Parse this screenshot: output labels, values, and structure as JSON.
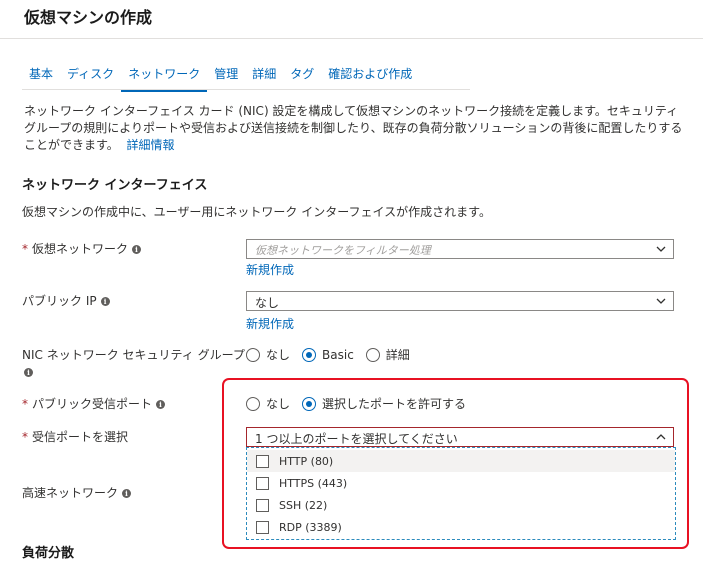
{
  "page": {
    "title": "仮想マシンの作成"
  },
  "tabs": [
    {
      "label": "基本"
    },
    {
      "label": "ディスク"
    },
    {
      "label": "ネットワーク"
    },
    {
      "label": "管理"
    },
    {
      "label": "詳細"
    },
    {
      "label": "タグ"
    },
    {
      "label": "確認および作成"
    }
  ],
  "active_tab": "ネットワーク",
  "description": {
    "text": "ネットワーク インターフェイス カード (NIC) 設定を構成して仮想マシンのネットワーク接続を定義します。セキュリティ グループの規則によりポートや受信および送信接続を制御したり、既存の負荷分散ソリューションの背後に配置したりすることができます。",
    "link": "詳細情報"
  },
  "network_interface": {
    "heading": "ネットワーク インターフェイス",
    "subtitle": "仮想マシンの作成中に、ユーザー用にネットワーク インターフェイスが作成されます。"
  },
  "fields": {
    "vnet": {
      "label": "仮想ネットワーク",
      "placeholder": "仮想ネットワークをフィルター処理",
      "create_link": "新規作成"
    },
    "public_ip": {
      "label": "パブリック IP",
      "value": "なし",
      "create_link": "新規作成"
    },
    "nsg": {
      "label": "NIC ネットワーク セキュリティ グループ",
      "options": [
        "なし",
        "Basic",
        "詳細"
      ],
      "selected": "Basic"
    },
    "public_inbound_ports": {
      "label": "パブリック受信ポート",
      "options": [
        "なし",
        "選択したポートを許可する"
      ],
      "selected": "選択したポートを許可する"
    },
    "select_inbound_ports": {
      "label": "受信ポートを選択",
      "placeholder": "1 つ以上のポートを選択してください",
      "options": [
        {
          "label": "HTTP (80)",
          "checked": false
        },
        {
          "label": "HTTPS (443)",
          "checked": false
        },
        {
          "label": "SSH (22)",
          "checked": false
        },
        {
          "label": "RDP (3389)",
          "checked": false
        }
      ]
    },
    "accelerated_networking": {
      "label": "高速ネットワーク"
    }
  },
  "load_balancing": {
    "heading": "負荷分散"
  },
  "colors": {
    "accent": "#0067b8",
    "required": "#a4262c",
    "highlight_box": "#e81123"
  }
}
